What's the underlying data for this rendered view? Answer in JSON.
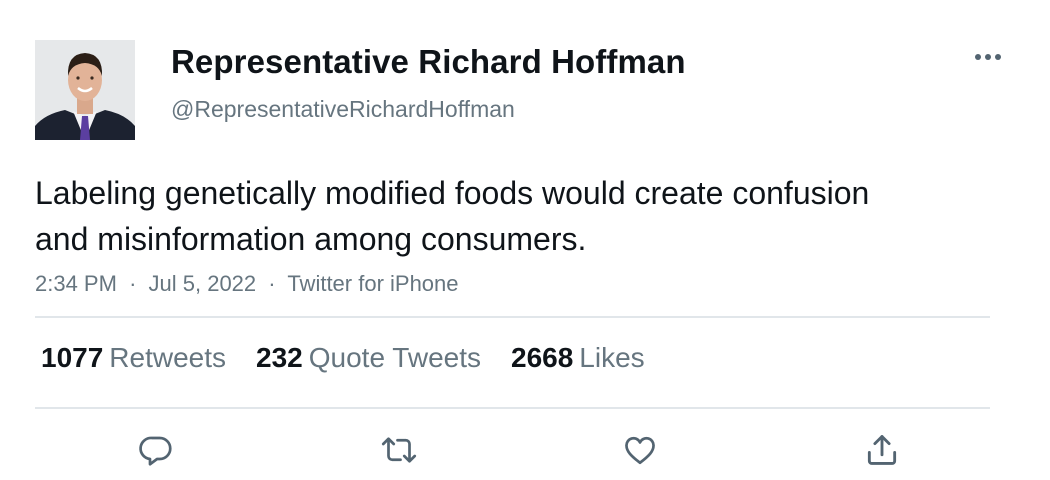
{
  "author": {
    "display_name": "Representative Richard Hoffman",
    "handle": "@RepresentativeRichardHoffman",
    "avatar_icon": "profile-photo"
  },
  "tweet": {
    "text": "Labeling genetically modified foods would create confusion and misinformation among consumers.",
    "time": "2:34 PM",
    "date": "Jul 5, 2022",
    "source": "Twitter for iPhone",
    "separator": "·"
  },
  "stats": {
    "retweets": {
      "count": "1077",
      "label": "Retweets"
    },
    "quote_tweets": {
      "count": "232",
      "label": "Quote Tweets"
    },
    "likes": {
      "count": "2668",
      "label": "Likes"
    }
  },
  "actions": [
    "reply-icon",
    "retweet-icon",
    "like-icon",
    "share-icon"
  ],
  "colors": {
    "text": "#0f1419",
    "secondary": "#66757f",
    "divider": "#e1e6ea",
    "icon": "#536471"
  }
}
